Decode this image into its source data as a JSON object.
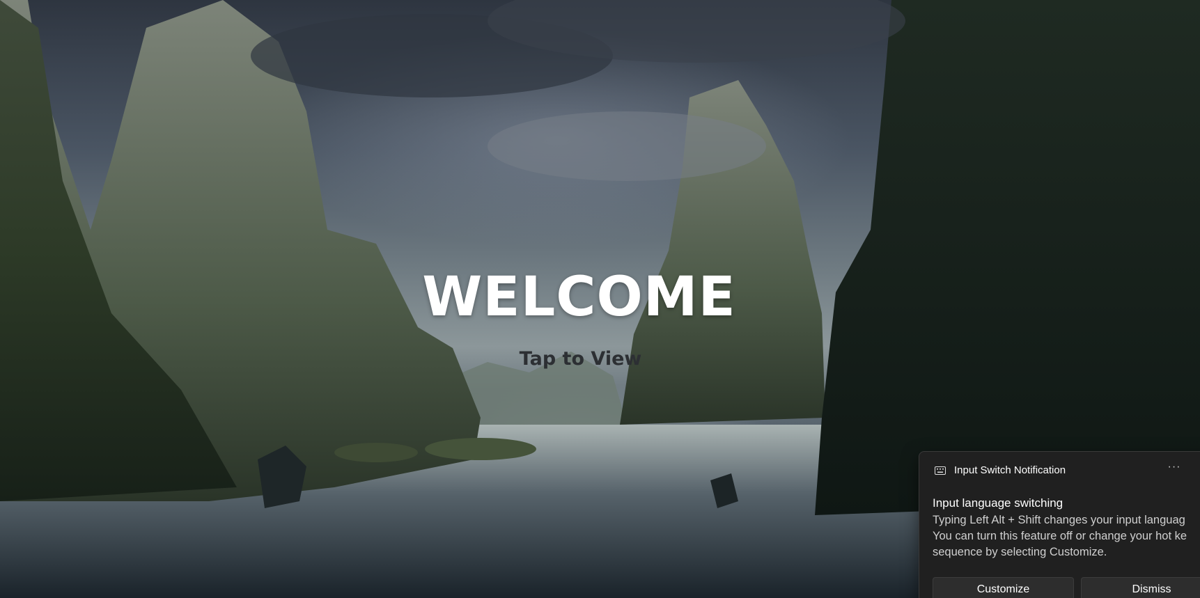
{
  "lock_screen": {
    "welcome_text": "WELCOME",
    "tap_text": "Tap to View"
  },
  "notification": {
    "app_icon": "keyboard-icon",
    "app_name": "Input Switch Notification",
    "more_icon": "more-options-icon",
    "more_glyph": "···",
    "title": "Input language switching",
    "body_lines": [
      "Typing Left Alt + Shift changes your input languag",
      "You can turn this feature off or change your hot ke",
      "sequence by selecting Customize."
    ],
    "customize_label": "Customize",
    "dismiss_label": "Dismiss"
  },
  "colors": {
    "toast_bg": "#202020",
    "welcome": "#ffffff",
    "tap": "#2c2f33"
  }
}
